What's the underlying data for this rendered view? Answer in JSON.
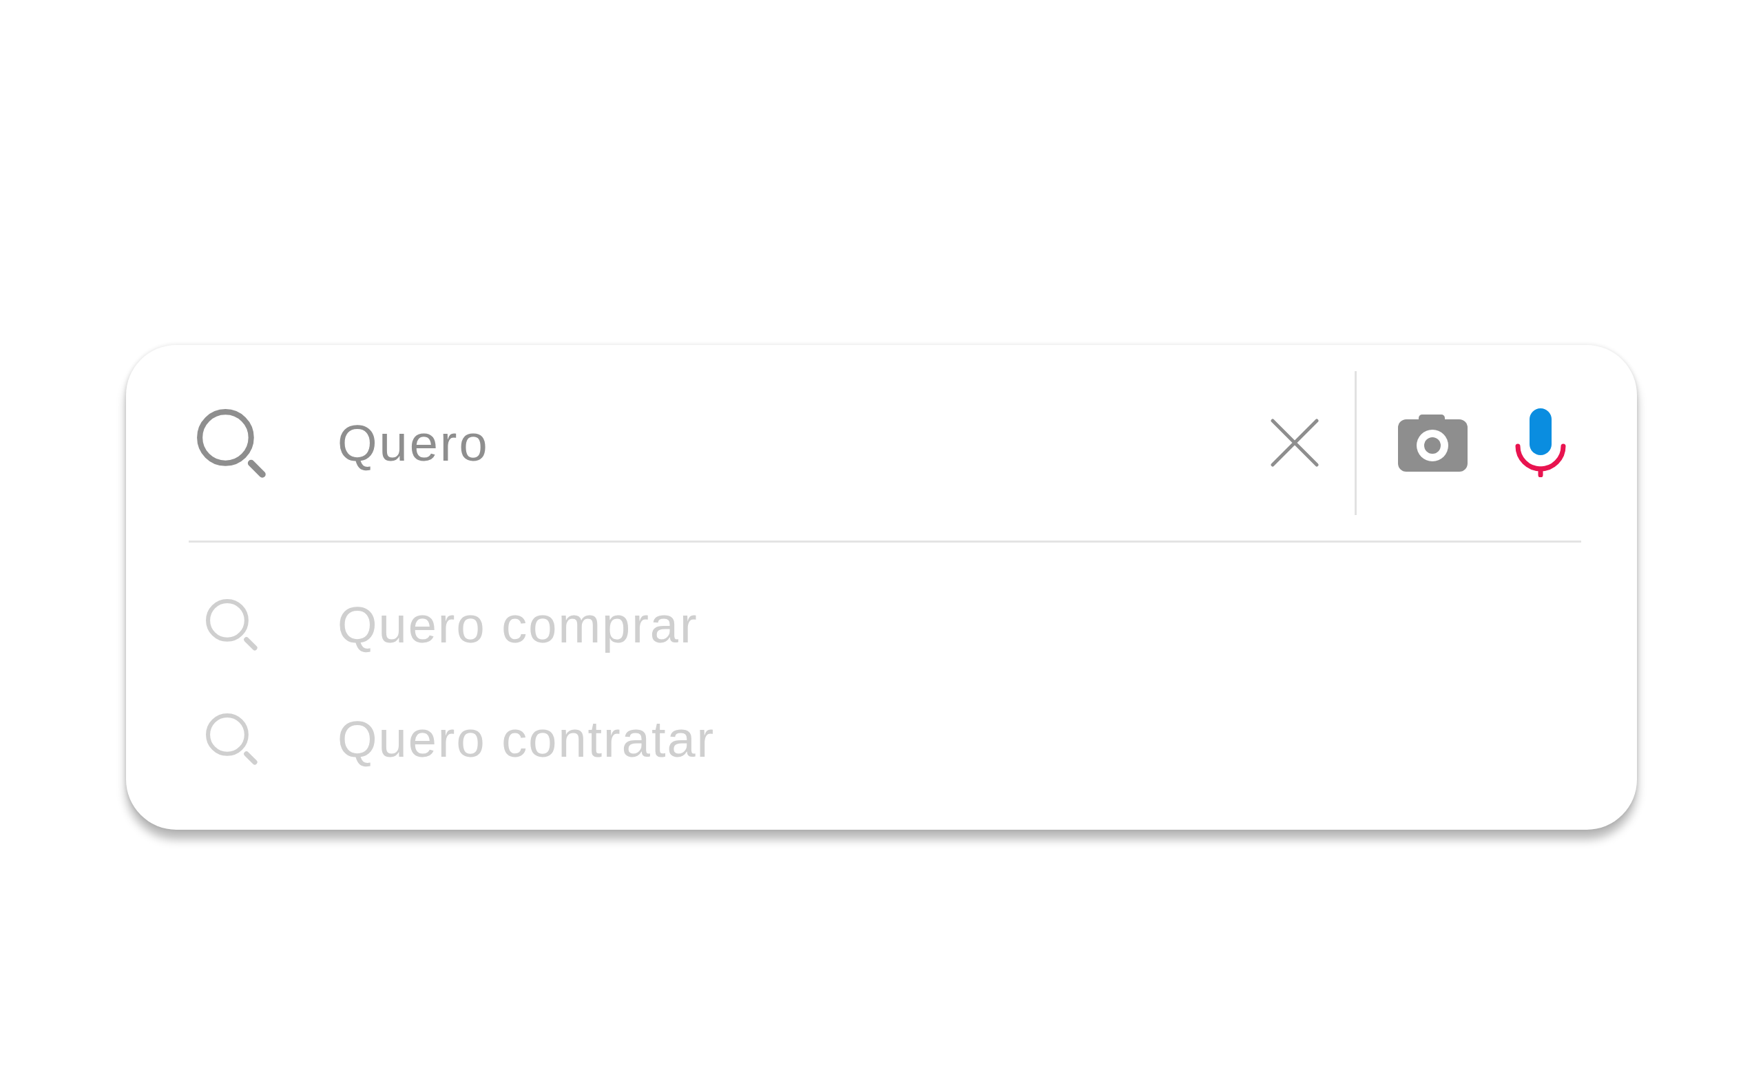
{
  "search": {
    "value": "Quero"
  },
  "suggestions": [
    {
      "text": "Quero comprar"
    },
    {
      "text": "Quero contratar"
    }
  ]
}
